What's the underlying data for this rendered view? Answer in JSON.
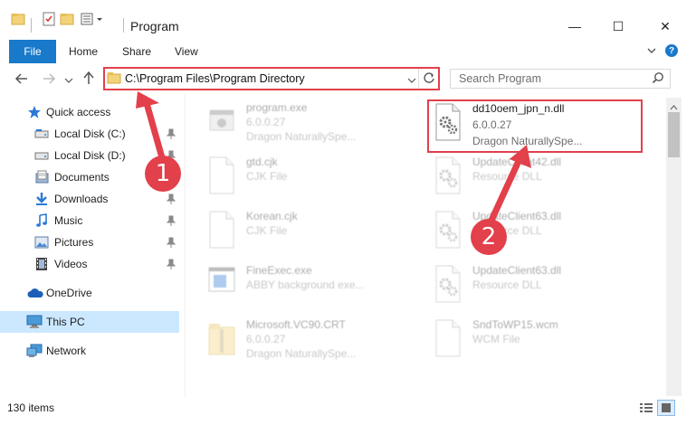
{
  "window": {
    "title": "Program",
    "minimize": "—",
    "maximize": "☐",
    "close": "✕"
  },
  "ribbon": {
    "tabs": [
      "File",
      "Home",
      "Share",
      "View"
    ]
  },
  "address": {
    "path": "C:\\Program Files\\Program Directory",
    "search_placeholder": "Search Program"
  },
  "nav": {
    "quick_access": "Quick access",
    "items": [
      {
        "label": "Local Disk (C:)",
        "icon": "drive-icon",
        "pinned": true
      },
      {
        "label": "Local Disk (D:)",
        "icon": "drive-icon",
        "pinned": true
      },
      {
        "label": "Documents",
        "icon": "documents-icon",
        "pinned": true
      },
      {
        "label": "Downloads",
        "icon": "downloads-icon",
        "pinned": true
      },
      {
        "label": "Music",
        "icon": "music-icon",
        "pinned": true
      },
      {
        "label": "Pictures",
        "icon": "pictures-icon",
        "pinned": true
      },
      {
        "label": "Videos",
        "icon": "videos-icon",
        "pinned": true
      }
    ],
    "onedrive": "OneDrive",
    "this_pc": "This PC",
    "network": "Network"
  },
  "files": [
    {
      "name": "program.exe",
      "line2": "6.0.0.27",
      "line3": "Dragon NaturallySpe...",
      "icon": "exe-icon",
      "faded": true
    },
    {
      "name": "dd10oem_jpn_n.dll",
      "line2": "6.0.0.27",
      "line3": "Dragon NaturallySpe...",
      "icon": "dll-gear-icon",
      "faded": false
    },
    {
      "name": "gtd.cjk",
      "line2": "CJK File",
      "line3": "",
      "icon": "blank-file-icon",
      "faded": true
    },
    {
      "name": "UpdateClient42.dll",
      "line2": "Resource DLL",
      "line3": "",
      "icon": "dll-gear-icon",
      "faded": true
    },
    {
      "name": "Korean.cjk",
      "line2": "CJK File",
      "line3": "",
      "icon": "blank-file-icon",
      "faded": true
    },
    {
      "name": "UpdateClient63.dll",
      "line2": "Resource DLL",
      "line3": "",
      "icon": "dll-gear-icon",
      "faded": true
    },
    {
      "name": "FineExec.exe",
      "line2": "ABBY background exe...",
      "line3": "",
      "icon": "app-window-icon",
      "faded": true
    },
    {
      "name": "UpdateClient63.dll",
      "line2": "Resource DLL",
      "line3": "",
      "icon": "dll-gear-icon",
      "faded": true
    },
    {
      "name": "Microsoft.VC90.CRT",
      "line2": "6.0.0.27",
      "line3": "Dragon NaturallySpe...",
      "icon": "zip-folder-icon",
      "faded": true
    },
    {
      "name": "SndToWP15.wcm",
      "line2": "WCM File",
      "line3": "",
      "icon": "blank-file-icon",
      "faded": true
    }
  ],
  "status": {
    "items": "130 items"
  },
  "annotations": {
    "badge1": "1",
    "badge2": "2"
  },
  "colors": {
    "accent": "#1979ca",
    "highlight": "#e2404b",
    "selected_nav": "#cce8ff"
  }
}
